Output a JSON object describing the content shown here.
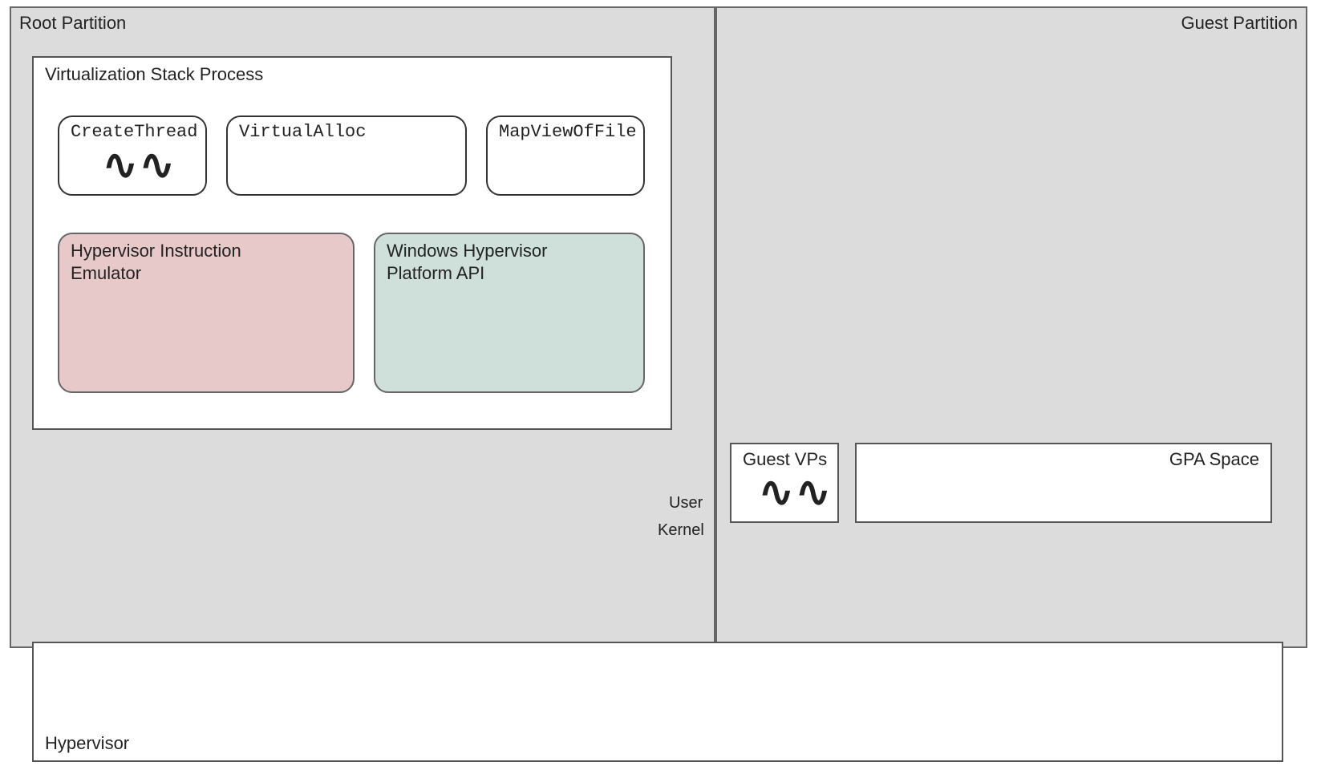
{
  "root_partition": {
    "title": "Root Partition"
  },
  "guest_partition": {
    "title": "Guest Partition"
  },
  "vsp": {
    "title": "Virtualization Stack Process"
  },
  "api_boxes": {
    "create_thread": "CreateThread",
    "virtual_alloc": "VirtualAlloc",
    "map_view": "MapViewOfFile"
  },
  "hie": {
    "title": "Hypervisor Instruction Emulator"
  },
  "whp": {
    "title": "Windows Hypervisor Platform API"
  },
  "mode_labels": {
    "user": "User",
    "kernel": "Kernel"
  },
  "guest_vps": {
    "title": "Guest VPs"
  },
  "gpa_space": {
    "title": "GPA Space"
  },
  "hypervisor": {
    "title": "Hypervisor"
  }
}
